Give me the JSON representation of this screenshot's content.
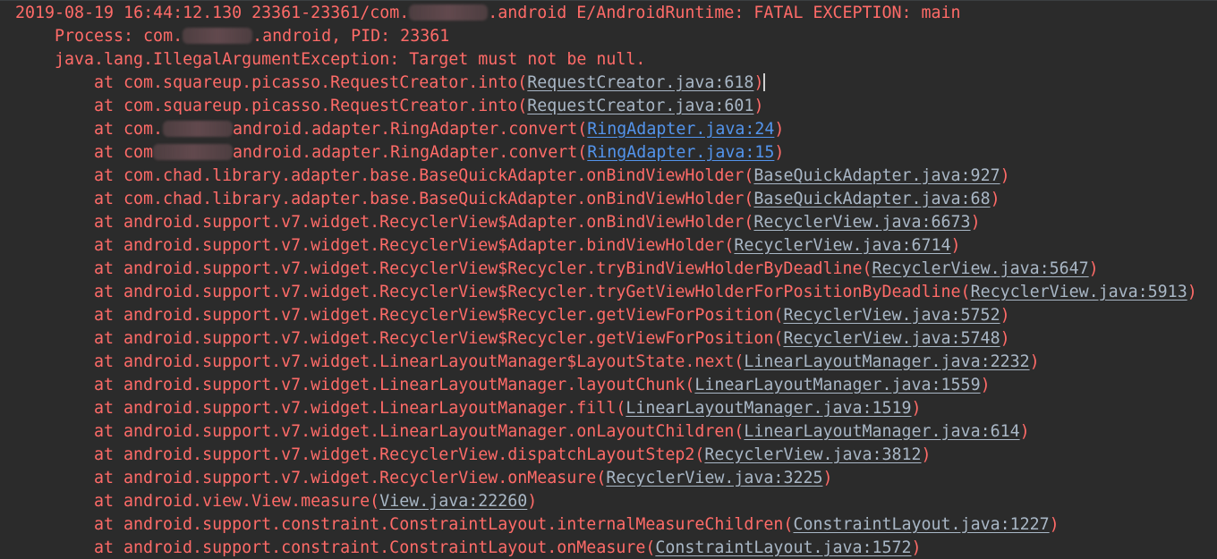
{
  "colors": {
    "background": "#2b2b2b",
    "error_text": "#ff6b68",
    "file_link": "#a9b7c6",
    "project_link": "#5394ec"
  },
  "lines": [
    {
      "indent": 0,
      "parts": [
        {
          "t": "text",
          "v": "2019-08-19 16:44:12.130 23361-23361/com."
        },
        {
          "t": "blur",
          "w": 88
        },
        {
          "t": "text",
          "v": ".android E/AndroidRuntime: FATAL EXCEPTION: main"
        }
      ]
    },
    {
      "indent": 1,
      "parts": [
        {
          "t": "text",
          "v": "Process: com."
        },
        {
          "t": "blur",
          "w": 78
        },
        {
          "t": "text",
          "v": ".android, PID: 23361"
        }
      ]
    },
    {
      "indent": 1,
      "parts": [
        {
          "t": "text",
          "v": "java.lang.IllegalArgumentException: Target must not be null."
        }
      ]
    },
    {
      "indent": 2,
      "parts": [
        {
          "t": "text",
          "v": "at com.squareup.picasso.RequestCreator.into("
        },
        {
          "t": "link",
          "v": "RequestCreator.java:618",
          "c": "gray"
        },
        {
          "t": "text",
          "v": ")"
        },
        {
          "t": "caret"
        }
      ]
    },
    {
      "indent": 2,
      "parts": [
        {
          "t": "text",
          "v": "at com.squareup.picasso.RequestCreator.into("
        },
        {
          "t": "link",
          "v": "RequestCreator.java:601",
          "c": "gray"
        },
        {
          "t": "text",
          "v": ")"
        }
      ]
    },
    {
      "indent": 2,
      "parts": [
        {
          "t": "text",
          "v": "at com."
        },
        {
          "t": "blur",
          "w": 78
        },
        {
          "t": "text",
          "v": "android.adapter.RingAdapter.convert("
        },
        {
          "t": "link",
          "v": "RingAdapter.java:24",
          "c": "blue"
        },
        {
          "t": "text",
          "v": ")"
        }
      ]
    },
    {
      "indent": 2,
      "parts": [
        {
          "t": "text",
          "v": "at com"
        },
        {
          "t": "blur",
          "w": 89
        },
        {
          "t": "text",
          "v": "android.adapter.RingAdapter.convert("
        },
        {
          "t": "link",
          "v": "RingAdapter.java:15",
          "c": "blue"
        },
        {
          "t": "text",
          "v": ")"
        }
      ]
    },
    {
      "indent": 2,
      "parts": [
        {
          "t": "text",
          "v": "at com.chad.library.adapter.base.BaseQuickAdapter.onBindViewHolder("
        },
        {
          "t": "link",
          "v": "BaseQuickAdapter.java:927",
          "c": "gray"
        },
        {
          "t": "text",
          "v": ")"
        }
      ]
    },
    {
      "indent": 2,
      "parts": [
        {
          "t": "text",
          "v": "at com.chad.library.adapter.base.BaseQuickAdapter.onBindViewHolder("
        },
        {
          "t": "link",
          "v": "BaseQuickAdapter.java:68",
          "c": "gray"
        },
        {
          "t": "text",
          "v": ")"
        }
      ]
    },
    {
      "indent": 2,
      "parts": [
        {
          "t": "text",
          "v": "at android.support.v7.widget.RecyclerView$Adapter.onBindViewHolder("
        },
        {
          "t": "link",
          "v": "RecyclerView.java:6673",
          "c": "gray"
        },
        {
          "t": "text",
          "v": ")"
        }
      ]
    },
    {
      "indent": 2,
      "parts": [
        {
          "t": "text",
          "v": "at android.support.v7.widget.RecyclerView$Adapter.bindViewHolder("
        },
        {
          "t": "link",
          "v": "RecyclerView.java:6714",
          "c": "gray"
        },
        {
          "t": "text",
          "v": ")"
        }
      ]
    },
    {
      "indent": 2,
      "parts": [
        {
          "t": "text",
          "v": "at android.support.v7.widget.RecyclerView$Recycler.tryBindViewHolderByDeadline("
        },
        {
          "t": "link",
          "v": "RecyclerView.java:5647",
          "c": "gray"
        },
        {
          "t": "text",
          "v": ")"
        }
      ]
    },
    {
      "indent": 2,
      "parts": [
        {
          "t": "text",
          "v": "at android.support.v7.widget.RecyclerView$Recycler.tryGetViewHolderForPositionByDeadline("
        },
        {
          "t": "link",
          "v": "RecyclerView.java:5913",
          "c": "gray"
        },
        {
          "t": "text",
          "v": ")"
        }
      ]
    },
    {
      "indent": 2,
      "parts": [
        {
          "t": "text",
          "v": "at android.support.v7.widget.RecyclerView$Recycler.getViewForPosition("
        },
        {
          "t": "link",
          "v": "RecyclerView.java:5752",
          "c": "gray"
        },
        {
          "t": "text",
          "v": ")"
        }
      ]
    },
    {
      "indent": 2,
      "parts": [
        {
          "t": "text",
          "v": "at android.support.v7.widget.RecyclerView$Recycler.getViewForPosition("
        },
        {
          "t": "link",
          "v": "RecyclerView.java:5748",
          "c": "gray"
        },
        {
          "t": "text",
          "v": ")"
        }
      ]
    },
    {
      "indent": 2,
      "parts": [
        {
          "t": "text",
          "v": "at android.support.v7.widget.LinearLayoutManager$LayoutState.next("
        },
        {
          "t": "link",
          "v": "LinearLayoutManager.java:2232",
          "c": "gray"
        },
        {
          "t": "text",
          "v": ")"
        }
      ]
    },
    {
      "indent": 2,
      "parts": [
        {
          "t": "text",
          "v": "at android.support.v7.widget.LinearLayoutManager.layoutChunk("
        },
        {
          "t": "link",
          "v": "LinearLayoutManager.java:1559",
          "c": "gray"
        },
        {
          "t": "text",
          "v": ")"
        }
      ]
    },
    {
      "indent": 2,
      "parts": [
        {
          "t": "text",
          "v": "at android.support.v7.widget.LinearLayoutManager.fill("
        },
        {
          "t": "link",
          "v": "LinearLayoutManager.java:1519",
          "c": "gray"
        },
        {
          "t": "text",
          "v": ")"
        }
      ]
    },
    {
      "indent": 2,
      "parts": [
        {
          "t": "text",
          "v": "at android.support.v7.widget.LinearLayoutManager.onLayoutChildren("
        },
        {
          "t": "link",
          "v": "LinearLayoutManager.java:614",
          "c": "gray"
        },
        {
          "t": "text",
          "v": ")"
        }
      ]
    },
    {
      "indent": 2,
      "parts": [
        {
          "t": "text",
          "v": "at android.support.v7.widget.RecyclerView.dispatchLayoutStep2("
        },
        {
          "t": "link",
          "v": "RecyclerView.java:3812",
          "c": "gray"
        },
        {
          "t": "text",
          "v": ")"
        }
      ]
    },
    {
      "indent": 2,
      "parts": [
        {
          "t": "text",
          "v": "at android.support.v7.widget.RecyclerView.onMeasure("
        },
        {
          "t": "link",
          "v": "RecyclerView.java:3225",
          "c": "gray"
        },
        {
          "t": "text",
          "v": ")"
        }
      ]
    },
    {
      "indent": 2,
      "parts": [
        {
          "t": "text",
          "v": "at android.view.View.measure("
        },
        {
          "t": "link",
          "v": "View.java:22260",
          "c": "gray"
        },
        {
          "t": "text",
          "v": ")"
        }
      ]
    },
    {
      "indent": 2,
      "parts": [
        {
          "t": "text",
          "v": "at android.support.constraint.ConstraintLayout.internalMeasureChildren("
        },
        {
          "t": "link",
          "v": "ConstraintLayout.java:1227",
          "c": "gray"
        },
        {
          "t": "text",
          "v": ")"
        }
      ]
    },
    {
      "indent": 2,
      "parts": [
        {
          "t": "text",
          "v": "at android.support.constraint.ConstraintLayout.onMeasure("
        },
        {
          "t": "link",
          "v": "ConstraintLayout.java:1572",
          "c": "gray"
        },
        {
          "t": "text",
          "v": ")"
        }
      ]
    }
  ]
}
